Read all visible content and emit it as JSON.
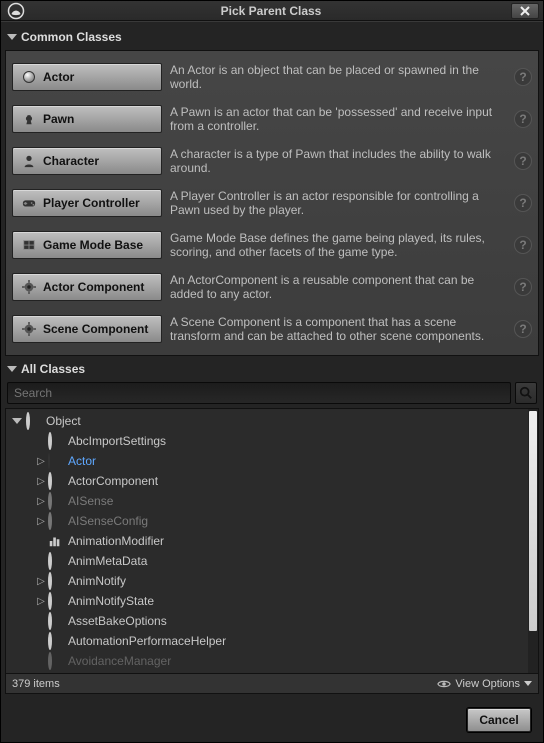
{
  "window": {
    "title": "Pick Parent Class"
  },
  "sections": {
    "common": "Common Classes",
    "all": "All Classes"
  },
  "common": [
    {
      "key": "actor",
      "label": "Actor",
      "desc": "An Actor is an object that can be placed or spawned in the world.",
      "icon": "sphere"
    },
    {
      "key": "pawn",
      "label": "Pawn",
      "desc": "A Pawn is an actor that can be 'possessed' and receive input from a controller.",
      "icon": "chess"
    },
    {
      "key": "character",
      "label": "Character",
      "desc": "A character is a type of Pawn that includes the ability to walk around.",
      "icon": "person"
    },
    {
      "key": "player-controller",
      "label": "Player Controller",
      "desc": "A Player Controller is an actor responsible for controlling a Pawn used by the player.",
      "icon": "gamepad"
    },
    {
      "key": "game-mode-base",
      "label": "Game Mode Base",
      "desc": "Game Mode Base defines the game being played, its rules, scoring, and other facets of the game type.",
      "icon": "board"
    },
    {
      "key": "actor-component",
      "label": "Actor Component",
      "desc": "An ActorComponent is a reusable component that can be added to any actor.",
      "icon": "gear"
    },
    {
      "key": "scene-component",
      "label": "Scene Component",
      "desc": "A Scene Component is a component that has a scene transform and can be attached to other scene components.",
      "icon": "gear"
    }
  ],
  "search": {
    "placeholder": "Search"
  },
  "tree": {
    "root": "Object",
    "items": [
      {
        "label": "AbcImportSettings",
        "expandable": false
      },
      {
        "label": "Actor",
        "expandable": true,
        "selected": true,
        "icon": "sphere"
      },
      {
        "label": "ActorComponent",
        "expandable": true
      },
      {
        "label": "AISense",
        "expandable": true,
        "dim": true
      },
      {
        "label": "AISenseConfig",
        "expandable": true,
        "dim": true
      },
      {
        "label": "AnimationModifier",
        "expandable": false,
        "icon": "bar"
      },
      {
        "label": "AnimMetaData",
        "expandable": false
      },
      {
        "label": "AnimNotify",
        "expandable": true
      },
      {
        "label": "AnimNotifyState",
        "expandable": true
      },
      {
        "label": "AssetBakeOptions",
        "expandable": false
      },
      {
        "label": "AutomationPerformaceHelper",
        "expandable": false
      },
      {
        "label": "AvoidanceManager",
        "expandable": false,
        "cut": true
      }
    ]
  },
  "status": {
    "count": "379 items",
    "view": "View Options"
  },
  "footer": {
    "cancel": "Cancel"
  }
}
